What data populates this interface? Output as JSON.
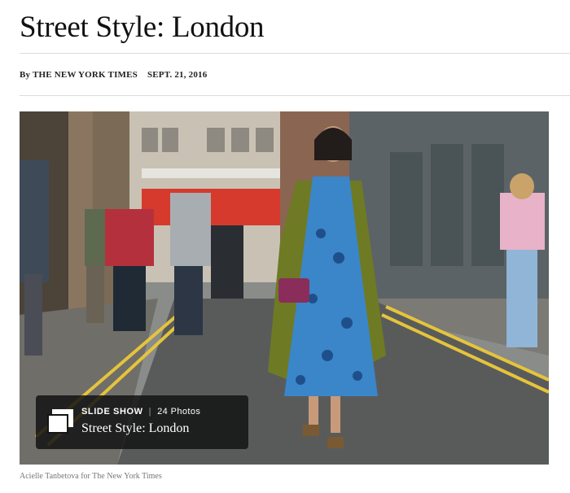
{
  "article": {
    "headline": "Street Style: London",
    "byline": "By THE NEW YORK TIMES",
    "date": "SEPT. 21, 2016"
  },
  "slideshow": {
    "label": "SLIDE SHOW",
    "separator": "|",
    "count": "24 Photos",
    "title": "Street Style: London",
    "icon": "slideshow-icon"
  },
  "photo": {
    "caption": "Acielle Tanbetova for The New York Times"
  }
}
